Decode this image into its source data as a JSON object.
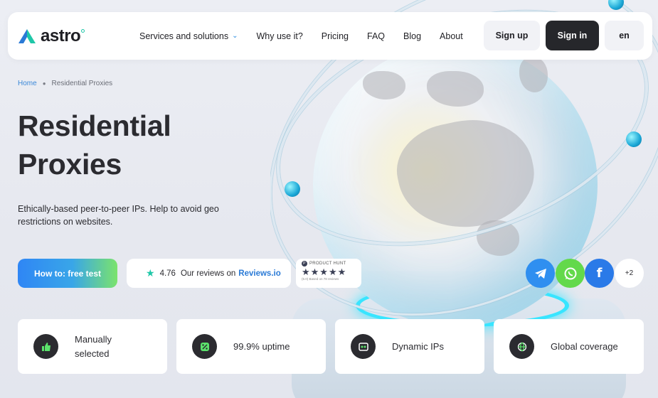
{
  "brand": {
    "name": "astro",
    "accent": "#1fc7a8"
  },
  "nav": {
    "items": [
      {
        "label": "Services and solutions",
        "has_dropdown": true
      },
      {
        "label": "Why use it?"
      },
      {
        "label": "Pricing"
      },
      {
        "label": "FAQ"
      },
      {
        "label": "Blog"
      },
      {
        "label": "About"
      }
    ],
    "signup_label": "Sign up",
    "signin_label": "Sign in",
    "lang_label": "en"
  },
  "breadcrumb": {
    "home": "Home",
    "current": "Residential Proxies"
  },
  "hero": {
    "title_line1": "Residential",
    "title_line2": "Proxies",
    "subtitle": "Ethically-based peer-to-peer IPs. Help to avoid geo restrictions on websites."
  },
  "cta": {
    "label": "How to: free test"
  },
  "reviews": {
    "score": "4.76",
    "text": "Our reviews on",
    "link": "Reviews.io"
  },
  "producthunt": {
    "label": "PRODUCT HUNT",
    "stars": "★★★★★",
    "sub": "(5.0) Based on 78 reviews"
  },
  "social": {
    "more": "+2"
  },
  "features": [
    {
      "label": "Manually selected",
      "icon": "thumbs-up-icon"
    },
    {
      "label": "99.9% uptime",
      "icon": "percent-icon"
    },
    {
      "label": "Dynamic IPs",
      "icon": "network-icon"
    },
    {
      "label": "Global coverage",
      "icon": "globe-icon"
    }
  ],
  "colors": {
    "cta_gradient_start": "#2f86f5",
    "cta_gradient_end": "#7be36c",
    "dark": "#26272b",
    "link": "#2a7ad6"
  }
}
